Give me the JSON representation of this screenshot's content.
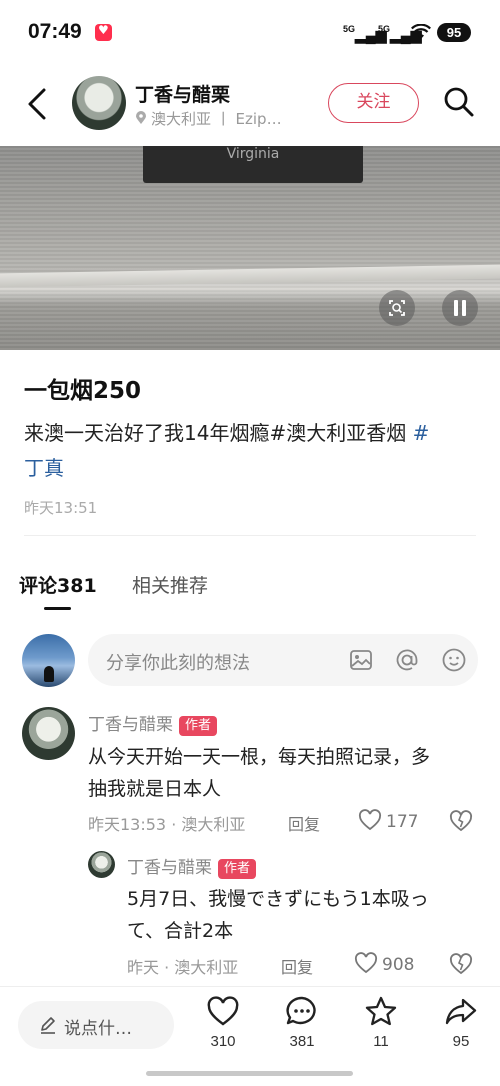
{
  "status_bar": {
    "time": "07:49",
    "net1": "5G",
    "net2": "5G",
    "battery": "95"
  },
  "header": {
    "author_name": "丁香与醋栗",
    "author_sub": "澳大利亚 丨 Ezip…",
    "follow_label": "关注"
  },
  "video": {
    "sign_text": "Virginia"
  },
  "post": {
    "title": "一包烟250",
    "body_line1": "来澳一天治好了我14年烟瘾#澳大利亚香烟",
    "body_tag_start": " #",
    "body_line2": "丁真",
    "time": "昨天13:51"
  },
  "tabs": {
    "comments": "评论381",
    "related": "相关推荐"
  },
  "comment_input": {
    "placeholder": "分享你此刻的想法"
  },
  "comments": [
    {
      "author": "丁香与醋栗",
      "badge": "作者",
      "text_line1": "从今天开始一天一根，每天拍照记录，多",
      "text_line2": "抽我就是日本人",
      "meta": "昨天13:53 · 澳大利亚",
      "reply": "回复",
      "likes": "177"
    },
    {
      "author": "丁香与醋栗",
      "badge": "作者",
      "text_line1": "5月7日、我慢できずにもう1本吸っ",
      "text_line2": "て、合計2本",
      "meta": "昨天 · 澳大利亚",
      "reply": "回复",
      "likes": "908"
    }
  ],
  "bottom_bar": {
    "say_label": "说点什…",
    "likes": "310",
    "comments": "381",
    "stars": "11",
    "shares": "95"
  },
  "colors": {
    "accent": "#d9475d",
    "badge": "#e8475f",
    "hashtag": "#2b5f9e"
  }
}
